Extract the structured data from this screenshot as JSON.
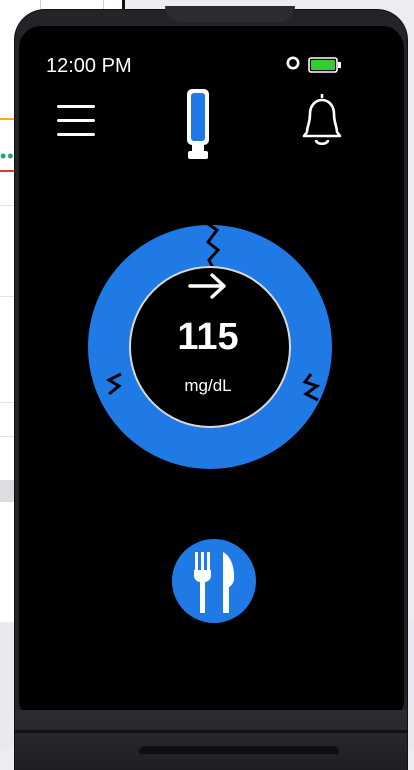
{
  "status_bar": {
    "time": "12:00 PM",
    "battery_color": "#33cc33",
    "icons": [
      "sensor-status-ring-icon",
      "battery-icon"
    ]
  },
  "toolbar": {
    "icons": [
      "menu-icon",
      "sensor-device-icon",
      "bell-icon"
    ]
  },
  "glucose": {
    "value": "115",
    "unit": "mg/dL",
    "trend": "arrow-right-icon",
    "ring_color": "#1f7ae6"
  },
  "actions": {
    "meal_icon": "fork-knife-icon",
    "meal_color": "#1f7ae6"
  }
}
